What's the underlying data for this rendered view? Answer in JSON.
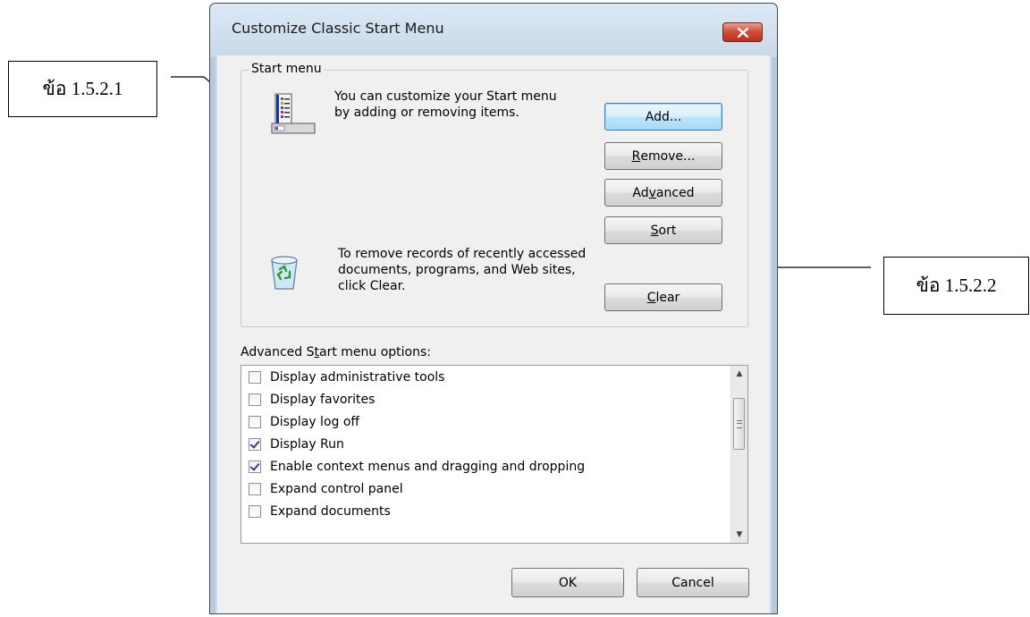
{
  "window": {
    "title": "Customize Classic Start Menu",
    "close_label": "close"
  },
  "start_menu_group": {
    "legend": "Start menu",
    "customize_text": "You can customize your Start menu by adding or removing items.",
    "clear_text": "To remove records of recently accessed documents, programs, and Web sites, click Clear.",
    "buttons": {
      "add": {
        "label": "Add...",
        "focused": true
      },
      "remove": {
        "mnemonic": "R",
        "rest": "emove..."
      },
      "advanced": {
        "pre": "Ad",
        "mnemonic": "v",
        "rest": "anced"
      },
      "sort": {
        "mnemonic": "S",
        "rest": "ort"
      },
      "clear": {
        "mnemonic": "C",
        "rest": "lear"
      }
    }
  },
  "advanced_options": {
    "label_pre": "Advanced S",
    "label_mnemonic": "t",
    "label_rest": "art menu options:",
    "items": [
      {
        "label": "Display administrative tools",
        "checked": false
      },
      {
        "label": "Display favorites",
        "checked": false
      },
      {
        "label": "Display log off",
        "checked": false
      },
      {
        "label": "Display Run",
        "checked": true
      },
      {
        "label": "Enable context menus and dragging and dropping",
        "checked": true
      },
      {
        "label": "Expand control panel",
        "checked": false
      },
      {
        "label": "Expand documents",
        "checked": false
      }
    ]
  },
  "footer": {
    "ok": "OK",
    "cancel": "Cancel"
  },
  "callouts": {
    "first": "ข้อ 1.5.2.1",
    "second": "ข้อ 1.5.2.2"
  },
  "icons": [
    "start-menu-icon",
    "recycle-bin-icon",
    "close-icon",
    "scroll-up-arrow-icon",
    "scroll-down-arrow-icon"
  ],
  "colors": {
    "close_button": "#cf4b36",
    "window_frame": "#cfdcea",
    "client_bg": "#f0f0f0",
    "focused_button": "#bee6fd"
  }
}
